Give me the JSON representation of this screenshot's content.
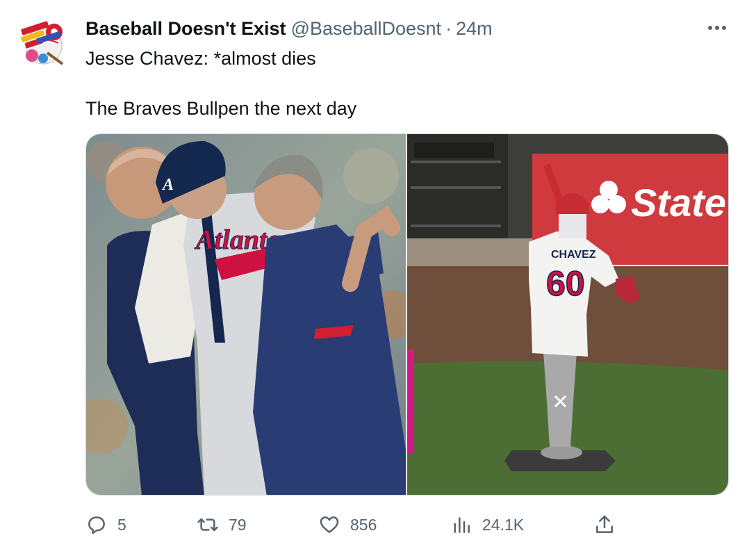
{
  "author": {
    "display_name": "Baseball Doesn't Exist",
    "handle": "@BaseballDoesnt",
    "separator": "·",
    "time": "24m",
    "avatar_icon": "baseball-doesnt-exist-logo"
  },
  "tweet": {
    "line1": "Jesse Chavez: *almost dies",
    "line2": "The Braves Bullpen the next day"
  },
  "media": {
    "left_photo": {
      "team_script": "Atlanta",
      "icon": "player-helped-off-field-photo"
    },
    "right_photo": {
      "jersey_name": "CHAVEZ",
      "jersey_number": "60",
      "sign_text": "State",
      "icon": "jersey-on-pitching-dummy-photo"
    }
  },
  "actions": {
    "reply_count": "5",
    "retweet_count": "79",
    "like_count": "856",
    "views_count": "24.1K"
  },
  "colors": {
    "text_primary": "#0f1419",
    "text_secondary": "#536471",
    "braves_navy": "#13274f",
    "braves_red": "#ce1141"
  }
}
